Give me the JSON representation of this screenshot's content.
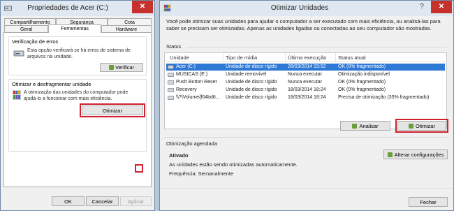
{
  "left_window": {
    "title": "Propriedades de Acer (C:)",
    "close_glyph": "✕",
    "tabs_row1": [
      "Compartilhamento",
      "Segurança",
      "Cota"
    ],
    "tabs_row2": [
      "Geral",
      "Ferramentas",
      "Hardware"
    ],
    "active_tab": "Ferramentas",
    "error_check": {
      "title": "Verificação de erros",
      "text": "Esta opção verificará se há erros de sistema de arquivos na unidade.",
      "button": "Verificar"
    },
    "optimize": {
      "title": "Otimizar e desfragmentar unidade",
      "text": "A otimização das unidades do computador pode ajudá-lo a funcionar com mais eficiência.",
      "button": "Otimizar"
    },
    "footer_buttons": [
      "OK",
      "Cancelar",
      "Aplicar"
    ]
  },
  "right_window": {
    "title": "Otimizar Unidades",
    "help_glyph": "?",
    "close_glyph": "✕",
    "intro": "Você pode otimizar suas unidades para ajudar o computador a ser executado com mais eficiência, ou analisá-las para saber se precisam ser otimizadas. Apenas as unidades ligadas ou conectadas ao seu computador são mostradas.",
    "status_label": "Status",
    "columns": [
      "Unidade",
      "Tipo de mídia",
      "Última execução",
      "Status atual"
    ],
    "rows": [
      {
        "unit": "Acer (C:)",
        "type": "Unidade de disco rígido",
        "last": "26/03/2014 15:52",
        "status": "OK (0% fragmentado)"
      },
      {
        "unit": "MÚSICAS (E:)",
        "type": "Unidade removível",
        "last": "Nunca executar",
        "status": "Otimização indisponível"
      },
      {
        "unit": "Push Button Reset",
        "type": "Unidade de disco rígido",
        "last": "Nunca executar",
        "status": "OK (0% fragmentado)"
      },
      {
        "unit": "Recovery",
        "type": "Unidade de disco rígido",
        "last": "18/03/2014 18:24",
        "status": "OK (0% fragmentado)"
      },
      {
        "unit": "\\\\?\\Volume{f04bd6...",
        "type": "Unidade de disco rígido",
        "last": "18/03/2014 18:24",
        "status": "Precisa de otimização (35% fragmentado)"
      }
    ],
    "analyze_button": "Analisar",
    "optimize_button": "Otimizar",
    "scheduled": {
      "label": "Otimização agendada",
      "state": "Ativado",
      "description": "As unidades estão sendo otimizadas automaticamente.",
      "frequency": "Frequência: Semanalmente",
      "change_button": "Alterar configurações"
    },
    "close_button": "Fechar"
  },
  "colors": {
    "selection": "#2f79d6",
    "highlight_box": "#d02030",
    "close": "#c7312b"
  }
}
